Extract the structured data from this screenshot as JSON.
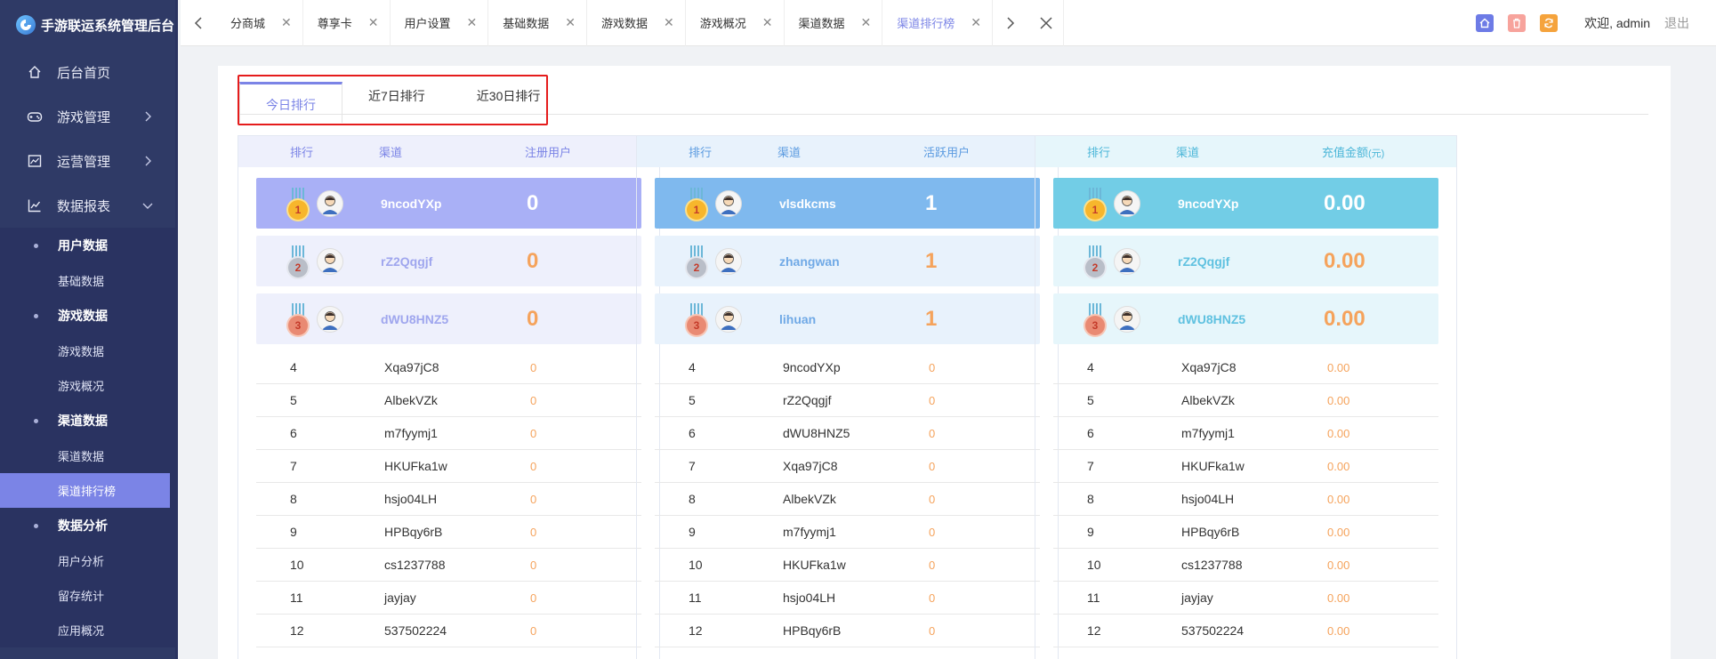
{
  "app": {
    "title": "手游联运系统管理后台"
  },
  "sidebar": {
    "items": [
      {
        "label": "后台首页",
        "icon": "home-icon"
      },
      {
        "label": "游戏管理",
        "icon": "gamepad-icon"
      },
      {
        "label": "运营管理",
        "icon": "chart-box-icon"
      },
      {
        "label": "数据报表",
        "icon": "line-chart-icon"
      }
    ],
    "groups": [
      {
        "label": "用户数据",
        "items": [
          "基础数据"
        ]
      },
      {
        "label": "游戏数据",
        "items": [
          "游戏数据",
          "游戏概况"
        ]
      },
      {
        "label": "渠道数据",
        "items": [
          "渠道数据",
          "渠道排行榜"
        ]
      },
      {
        "label": "数据分析",
        "items": [
          "用户分析",
          "留存统计",
          "应用概况"
        ]
      }
    ],
    "active_item": "渠道排行榜"
  },
  "topbar": {
    "tabs": [
      "分商城",
      "尊享卡",
      "用户设置",
      "基础数据",
      "游戏数据",
      "游戏概况",
      "渠道数据",
      "渠道排行榜"
    ],
    "active_tab": "渠道排行榜",
    "welcome": "欢迎, admin",
    "logout": "退出"
  },
  "rank_tabs": [
    "今日排行",
    "近7日排行",
    "近30日排行"
  ],
  "colors": {
    "accent": "#7b84e6",
    "highlight": "#e51c1c",
    "value": "#f5a35c"
  },
  "panels": [
    {
      "head": {
        "rank": "排行",
        "channel": "渠道",
        "value": "注册用户",
        "unit": ""
      },
      "head_bg": "#eef0fc",
      "head_color": "#7b84e6",
      "top_bg": "#a9b0f6",
      "top_light_bg": "#eef0fc",
      "top_name_color": "#fff",
      "light_name_color": "#9fa6ee",
      "top": [
        {
          "rank": "1",
          "channel": "9ncodYXp",
          "value": "0"
        },
        {
          "rank": "2",
          "channel": "rZ2Qqgjf",
          "value": "0"
        },
        {
          "rank": "3",
          "channel": "dWU8HNZ5",
          "value": "0"
        }
      ],
      "rows": [
        {
          "rank": "4",
          "channel": "Xqa97jC8",
          "value": "0"
        },
        {
          "rank": "5",
          "channel": "AlbekVZk",
          "value": "0"
        },
        {
          "rank": "6",
          "channel": "m7fyymj1",
          "value": "0"
        },
        {
          "rank": "7",
          "channel": "HKUFka1w",
          "value": "0"
        },
        {
          "rank": "8",
          "channel": "hsjo04LH",
          "value": "0"
        },
        {
          "rank": "9",
          "channel": "HPBqy6rB",
          "value": "0"
        },
        {
          "rank": "10",
          "channel": "cs1237788",
          "value": "0"
        },
        {
          "rank": "11",
          "channel": "jayjay",
          "value": "0"
        },
        {
          "rank": "12",
          "channel": "537502224",
          "value": "0"
        }
      ]
    },
    {
      "head": {
        "rank": "排行",
        "channel": "渠道",
        "value": "活跃用户",
        "unit": ""
      },
      "head_bg": "#e8f2fc",
      "head_color": "#5b9be0",
      "top_bg": "#7fb9ee",
      "top_light_bg": "#e8f2fc",
      "top_name_color": "#fff",
      "light_name_color": "#70a9e6",
      "top": [
        {
          "rank": "1",
          "channel": "vlsdkcms",
          "value": "1"
        },
        {
          "rank": "2",
          "channel": "zhangwan",
          "value": "1"
        },
        {
          "rank": "3",
          "channel": "lihuan",
          "value": "1"
        }
      ],
      "rows": [
        {
          "rank": "4",
          "channel": "9ncodYXp",
          "value": "0"
        },
        {
          "rank": "5",
          "channel": "rZ2Qqgjf",
          "value": "0"
        },
        {
          "rank": "6",
          "channel": "dWU8HNZ5",
          "value": "0"
        },
        {
          "rank": "7",
          "channel": "Xqa97jC8",
          "value": "0"
        },
        {
          "rank": "8",
          "channel": "AlbekVZk",
          "value": "0"
        },
        {
          "rank": "9",
          "channel": "m7fyymj1",
          "value": "0"
        },
        {
          "rank": "10",
          "channel": "HKUFka1w",
          "value": "0"
        },
        {
          "rank": "11",
          "channel": "hsjo04LH",
          "value": "0"
        },
        {
          "rank": "12",
          "channel": "HPBqy6rB",
          "value": "0"
        }
      ]
    },
    {
      "head": {
        "rank": "排行",
        "channel": "渠道",
        "value": "充值金额",
        "unit": "(元)"
      },
      "head_bg": "#e6f6fb",
      "head_color": "#4bb6d8",
      "top_bg": "#72cde6",
      "top_light_bg": "#e6f6fb",
      "top_name_color": "#fff",
      "light_name_color": "#5fc1e0",
      "top": [
        {
          "rank": "1",
          "channel": "9ncodYXp",
          "value": "0.00"
        },
        {
          "rank": "2",
          "channel": "rZ2Qqgjf",
          "value": "0.00"
        },
        {
          "rank": "3",
          "channel": "dWU8HNZ5",
          "value": "0.00"
        }
      ],
      "rows": [
        {
          "rank": "4",
          "channel": "Xqa97jC8",
          "value": "0.00"
        },
        {
          "rank": "5",
          "channel": "AlbekVZk",
          "value": "0.00"
        },
        {
          "rank": "6",
          "channel": "m7fyymj1",
          "value": "0.00"
        },
        {
          "rank": "7",
          "channel": "HKUFka1w",
          "value": "0.00"
        },
        {
          "rank": "8",
          "channel": "hsjo04LH",
          "value": "0.00"
        },
        {
          "rank": "9",
          "channel": "HPBqy6rB",
          "value": "0.00"
        },
        {
          "rank": "10",
          "channel": "cs1237788",
          "value": "0.00"
        },
        {
          "rank": "11",
          "channel": "jayjay",
          "value": "0.00"
        },
        {
          "rank": "12",
          "channel": "537502224",
          "value": "0.00"
        }
      ]
    }
  ]
}
